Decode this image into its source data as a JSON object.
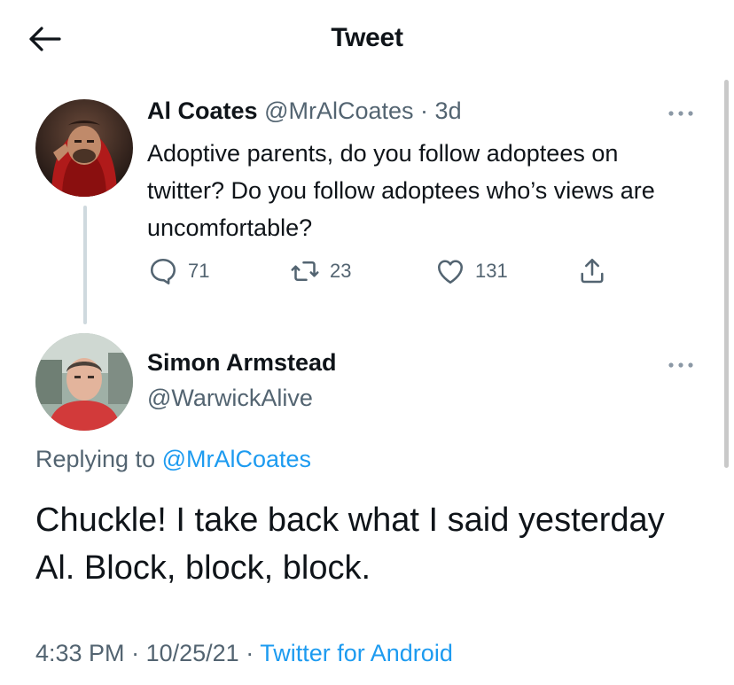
{
  "header": {
    "title": "Tweet",
    "back_icon": "arrow-left-icon"
  },
  "parent_tweet": {
    "author_name": "Al Coates",
    "author_handle": "@MrAlCoates",
    "separator": "·",
    "time_ago": "3d",
    "text": "Adoptive parents, do you follow adoptees on twitter? Do you follow adoptees who’s views are uncomfortable?",
    "actions": {
      "replies": "71",
      "retweets": "23",
      "likes": "131"
    }
  },
  "main_tweet": {
    "author_name": "Simon Armstead",
    "author_handle": "@WarwickAlive",
    "replying_prefix": "Replying to ",
    "replying_handle": "@MrAlCoates",
    "text": "Chuckle! I take back what I said yesterday Al. Block, block, block.",
    "time": "4:33 PM",
    "date": "10/25/21",
    "dot": "·",
    "source": "Twitter for Android"
  },
  "colors": {
    "accent": "#1d9bf0",
    "muted": "#536471",
    "text": "#0f1419",
    "thread_line": "#cfd9de"
  }
}
